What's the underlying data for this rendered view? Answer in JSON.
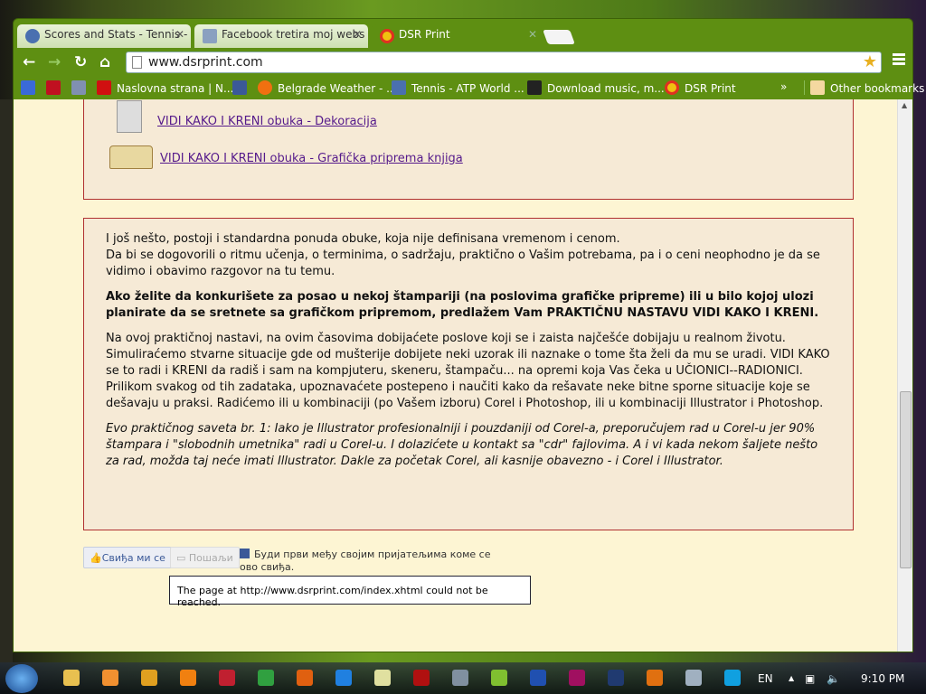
{
  "browser": {
    "tabs": [
      {
        "title": "Scores and Stats - Tennis -",
        "icon": "atp-icon",
        "color": "#4a70b0"
      },
      {
        "title": "Facebook tretira moj webs",
        "icon": "mc-icon",
        "color": "#8aa0c0"
      },
      {
        "title": "DSR Print",
        "icon": "dsr-icon",
        "color": "#e03020"
      }
    ],
    "url": "www.dsrprint.com",
    "bookmarks": [
      {
        "label": "",
        "icon": "google-icon",
        "color": "#3a6ad8"
      },
      {
        "label": "",
        "icon": "b-icon",
        "color": "#c01020"
      },
      {
        "label": "",
        "icon": "rtc-icon",
        "color": "#8090b0"
      },
      {
        "label": "Naslovna strana | N...",
        "icon": "h-icon",
        "color": "#d01010"
      },
      {
        "label": "",
        "icon": "facebook-icon",
        "color": "#3b5998"
      },
      {
        "label": "Belgrade Weather - ...",
        "icon": "sun-icon",
        "color": "#f07010"
      },
      {
        "label": "Tennis - ATP World ...",
        "icon": "atp-icon",
        "color": "#4a70b0"
      },
      {
        "label": "Download music, m...",
        "icon": "download-icon",
        "color": "#222"
      },
      {
        "label": "DSR Print",
        "icon": "dsr-icon",
        "color": "#e03020"
      }
    ],
    "overflow": "»",
    "other_bookmarks": "Other bookmarks"
  },
  "page": {
    "links": [
      "VIDI KAKO I KRENI obuka - Dekoracija",
      "VIDI KAKO I KRENI obuka - Grafička priprema knjiga"
    ],
    "para1a": "I još nešto, postoji i standardna ponuda obuke, koja nije definisana vremenom i cenom.",
    "para1b": "Da bi se dogovorili o ritmu učenja, o terminima, o sadržaju, praktično o Vašim potrebama, pa i o ceni neophodno je da se vidimo i obavimo razgovor na tu temu.",
    "para2": "Ako želite da konkurišete za posao u nekoj štampariji (na poslovima grafičke pripreme) ili u bilo kojoj ulozi planirate da se sretnete sa grafičkom pripremom, predlažem Vam PRAKTIČNU NASTAVU VIDI KAKO I KRENI.",
    "para3": "Na ovoj praktičnoj nastavi, na ovim časovima dobijaćete poslove koji se i zaista najčešće dobijaju u realnom životu. Simuliraćemo stvarne situacije gde od mušterije dobijete neki uzorak ili naznake o tome šta želi da mu se uradi. VIDI KAKO se to radi i KRENI da radiš i sam na kompjuteru, skeneru, štampaču... na opremi koja Vas čeka u UČIONICI--RADIONICI. Prilikom svakog od tih zadataka, upoznavaćete postepeno i naučiti kako da rešavate neke bitne sporne situacije koje se dešavaju u praksi. Radićemo ili u kombinaciji (po Vašem izboru) Corel i Photoshop, ili u kombinaciji Illustrator i Photoshop.",
    "para4": "Evo praktičnog saveta br. 1: Iako je Illustrator profesionalniji i pouzdaniji od Corel-a, preporučujem rad u Corel-u jer 90% štampara i \"slobodnih umetnika\" radi u Corel-u. I dolazićete u kontakt sa \"cdr\" fajlovima. A i vi kada nekom šaljete nešto za rad, možda taj neće imati Illustrator. Dakle za početak Corel, ali kasnije obavezno - i Corel i Illustrator.",
    "like_label": "Свиђа ми се",
    "send_label": "Пошаљи",
    "fb_text": "Буди први међу својим пријатељима коме се ово свиђа.",
    "error_tip": "The page at http://www.dsrprint.com/index.xhtml could not be reached."
  },
  "taskbar": {
    "apps": [
      {
        "icon": "explorer-icon",
        "color": "#e8c050"
      },
      {
        "icon": "app-icon",
        "color": "#f09030"
      },
      {
        "icon": "pencil-icon",
        "color": "#e0a020"
      },
      {
        "icon": "orange-icon",
        "color": "#f08010"
      },
      {
        "icon": "floppy-icon",
        "color": "#c02030"
      },
      {
        "icon": "chrome-icon",
        "color": "#30a040"
      },
      {
        "icon": "firefox-icon",
        "color": "#e06010"
      },
      {
        "icon": "ie-icon",
        "color": "#2080e0"
      },
      {
        "icon": "notepad-icon",
        "color": "#e0e0a0"
      },
      {
        "icon": "filezilla-icon",
        "color": "#b01010"
      },
      {
        "icon": "app2-icon",
        "color": "#8090a0"
      },
      {
        "icon": "green-app-icon",
        "color": "#80c030"
      },
      {
        "icon": "word-icon",
        "color": "#2050b0"
      },
      {
        "icon": "indesign-icon",
        "color": "#a01060"
      },
      {
        "icon": "photoshop-icon",
        "color": "#203a70"
      },
      {
        "icon": "illustrator-icon",
        "color": "#e07010"
      },
      {
        "icon": "calculator-icon",
        "color": "#a0b0c0"
      },
      {
        "icon": "skype-icon",
        "color": "#10a0e0"
      }
    ],
    "lang": "EN",
    "time": "9:10 PM"
  }
}
